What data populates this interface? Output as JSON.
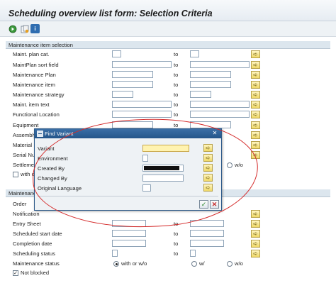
{
  "window": {
    "title": "Scheduling overview list form: Selection Criteria"
  },
  "toolbar": {
    "icons": [
      "execute-icon",
      "get-variant-icon",
      "information-icon"
    ],
    "info_glyph": "i"
  },
  "section_maintenance_item": {
    "heading": "Maintenance item selection",
    "to_label": "to",
    "rows": [
      {
        "label": "Maint. plan cat."
      },
      {
        "label": "MaintPlan sort field"
      },
      {
        "label": "Maintenance Plan"
      },
      {
        "label": "Maintenance item"
      },
      {
        "label": "Maintenance strategy"
      },
      {
        "label": "Maint. item text"
      },
      {
        "label": "Functional Location"
      },
      {
        "label": "Equipment"
      },
      {
        "label": "Assembly"
      },
      {
        "label": "Material"
      },
      {
        "label": "Serial Nu"
      },
      {
        "label": "Settleme"
      }
    ],
    "with_checkbox_label": "with c",
    "wo_radio_label": "w/o"
  },
  "section_maintenance_call": {
    "heading": "Maintenance",
    "rows": [
      {
        "label": "Order"
      },
      {
        "label": "Notification"
      },
      {
        "label": "Entry Sheet"
      },
      {
        "label": "Scheduled start date"
      },
      {
        "label": "Completion date"
      },
      {
        "label": "Scheduling status"
      }
    ],
    "status_label": "Maintenance status",
    "status_options": {
      "with_or_wo": "with or w/o",
      "with": "w/",
      "without": "w/o"
    },
    "not_blocked_label": "Not blocked",
    "not_blocked_checked": true
  },
  "dialog": {
    "title": "Find Variant",
    "fields": [
      {
        "label": "Variant"
      },
      {
        "label": "Environment"
      },
      {
        "label": "Created By"
      },
      {
        "label": "Changed By"
      },
      {
        "label": "Original Language"
      }
    ],
    "ok_glyph": "✓",
    "cancel_glyph": "✕"
  },
  "colors": {
    "accent_blue": "#24558a",
    "annotation_red": "#d42a2a",
    "highlight_yellow": "#fff3b0"
  }
}
